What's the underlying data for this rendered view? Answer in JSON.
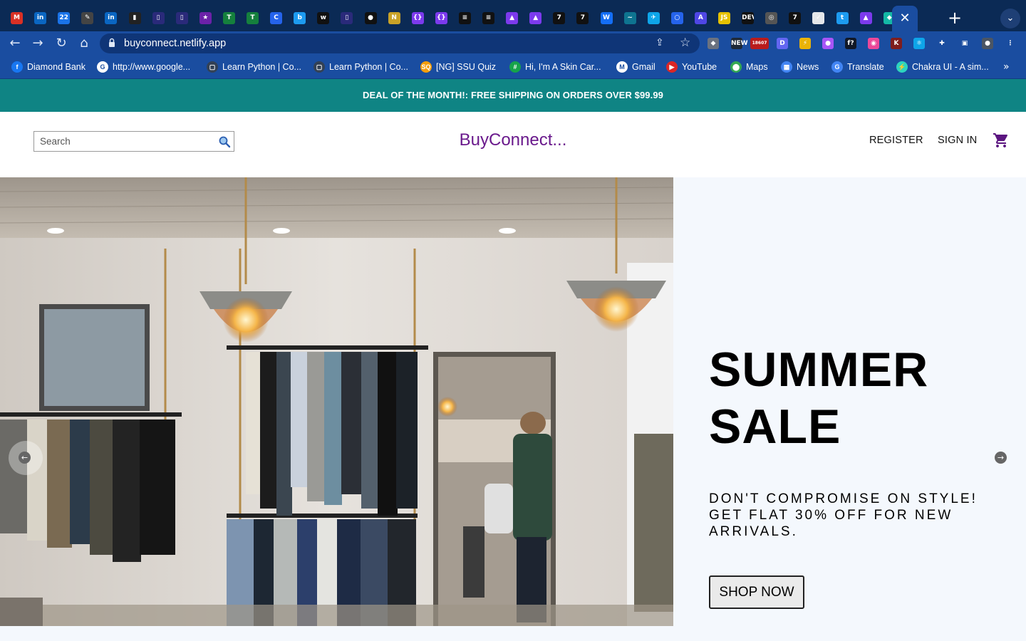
{
  "browser": {
    "tab_favicons": [
      {
        "name": "gmail-icon",
        "glyph": "M",
        "color": "#d93025"
      },
      {
        "name": "linkedin-icon",
        "glyph": "in",
        "color": "#0a66c2"
      },
      {
        "name": "calendar-icon",
        "glyph": "22",
        "color": "#1a73e8"
      },
      {
        "name": "pen-icon",
        "glyph": "✎",
        "color": "#444444"
      },
      {
        "name": "linkedin-icon",
        "glyph": "in",
        "color": "#0a66c2"
      },
      {
        "name": "chart-icon",
        "glyph": "▮",
        "color": "#222222"
      },
      {
        "name": "figure-icon",
        "glyph": "▯",
        "color": "#2a2a7a"
      },
      {
        "name": "figure-icon",
        "glyph": "▯",
        "color": "#2a2a7a"
      },
      {
        "name": "star-icon",
        "glyph": "★",
        "color": "#6b21a8"
      },
      {
        "name": "tree-icon",
        "glyph": "T",
        "color": "#15803d"
      },
      {
        "name": "tree-icon",
        "glyph": "T",
        "color": "#15803d"
      },
      {
        "name": "c-icon",
        "glyph": "C",
        "color": "#2563eb"
      },
      {
        "name": "bird-icon",
        "glyph": "b",
        "color": "#1d9bf0"
      },
      {
        "name": "w-icon",
        "glyph": "w",
        "color": "#111111"
      },
      {
        "name": "figure-icon",
        "glyph": "▯",
        "color": "#2a2a7a"
      },
      {
        "name": "github-icon",
        "glyph": "●",
        "color": "#111111"
      },
      {
        "name": "node-icon",
        "glyph": "N",
        "color": "#c9a227"
      },
      {
        "name": "bracket-icon",
        "glyph": "{}",
        "color": "#7c3aed"
      },
      {
        "name": "bracket-icon",
        "glyph": "{}",
        "color": "#7c3aed"
      },
      {
        "name": "stack-icon",
        "glyph": "≡",
        "color": "#111111"
      },
      {
        "name": "stack-icon",
        "glyph": "≡",
        "color": "#111111"
      },
      {
        "name": "rocket-icon",
        "glyph": "▲",
        "color": "#7c3aed"
      },
      {
        "name": "rocket-icon",
        "glyph": "▲",
        "color": "#7c3aed"
      },
      {
        "name": "seven-icon",
        "glyph": "7",
        "color": "#111111"
      },
      {
        "name": "seven-icon",
        "glyph": "7",
        "color": "#111111"
      },
      {
        "name": "webflow-icon",
        "glyph": "W",
        "color": "#146ef5"
      },
      {
        "name": "tailwind-icon",
        "glyph": "~",
        "color": "#0e7490"
      },
      {
        "name": "bird-icon",
        "glyph": "✈",
        "color": "#0ea5e9"
      },
      {
        "name": "circle-icon",
        "glyph": "○",
        "color": "#2563eb"
      },
      {
        "name": "triangle-icon",
        "glyph": "A",
        "color": "#4f46e5"
      },
      {
        "name": "js-icon",
        "glyph": "JS",
        "color": "#e5c100"
      },
      {
        "name": "dev-icon",
        "glyph": "DEV",
        "color": "#111111"
      },
      {
        "name": "globe-icon",
        "glyph": "◎",
        "color": "#555555"
      },
      {
        "name": "seven-icon",
        "glyph": "7",
        "color": "#111111"
      },
      {
        "name": "doc-icon",
        "glyph": "✓",
        "color": "#e5e7eb"
      },
      {
        "name": "twitter-icon",
        "glyph": "t",
        "color": "#1d9bf0"
      },
      {
        "name": "rocket-icon",
        "glyph": "▲",
        "color": "#7c3aed"
      },
      {
        "name": "diamond-icon",
        "glyph": "◆",
        "color": "#14b8a6"
      }
    ],
    "active_tab_close": "✕",
    "new_tab": "+",
    "tab_menu": "⌄",
    "nav": {
      "back": "←",
      "forward": "→",
      "reload": "↻",
      "home": "⌂"
    },
    "url": "buyconnect.netlify.app",
    "extensions": [
      {
        "name": "puzzle-gray-icon",
        "glyph": "◆",
        "color": "#6b7280"
      },
      {
        "name": "new-badge-icon",
        "glyph": "NEW",
        "color": "#1f2937"
      },
      {
        "name": "mail-counter-icon",
        "glyph": "18607",
        "color": "#b91c1c"
      },
      {
        "name": "d-icon",
        "glyph": "D",
        "color": "#6366f1"
      },
      {
        "name": "bolt-icon",
        "glyph": "⚡",
        "color": "#eab308"
      },
      {
        "name": "ghost-icon",
        "glyph": "●",
        "color": "#a855f7"
      },
      {
        "name": "function-icon",
        "glyph": "f?",
        "color": "#111827"
      },
      {
        "name": "color-wheel-icon",
        "glyph": "◉",
        "color": "#ec4899"
      },
      {
        "name": "k-icon",
        "glyph": "K",
        "color": "#7f1d1d"
      },
      {
        "name": "react-icon",
        "glyph": "⚛",
        "color": "#0ea5e9"
      },
      {
        "name": "extensions-puzzle-icon",
        "glyph": "✚",
        "color": "#1a4da0"
      },
      {
        "name": "sidebar-icon",
        "glyph": "▣",
        "color": "#1a4da0"
      },
      {
        "name": "profile-avatar-icon",
        "glyph": "●",
        "color": "#4b5563"
      },
      {
        "name": "menu-kebab-icon",
        "glyph": "⋮",
        "color": "#1a4da0"
      }
    ],
    "bookmarks": [
      {
        "label": "Diamond Bank",
        "icon": "f",
        "color": "#1877f2"
      },
      {
        "label": "http://www.google...",
        "icon": "G",
        "color": "#ffffff"
      },
      {
        "label": "Learn Python | Co...",
        "icon": "▢",
        "color": "#334155"
      },
      {
        "label": "Learn Python | Co...",
        "icon": "▢",
        "color": "#334155"
      },
      {
        "label": "[NG] SSU Quiz",
        "icon": "SQ",
        "color": "#f59e0b"
      },
      {
        "label": "Hi, I'm A Skin Car...",
        "icon": "#",
        "color": "#16a34a"
      },
      {
        "label": "Gmail",
        "icon": "M",
        "color": "#ffffff"
      },
      {
        "label": "YouTube",
        "icon": "▶",
        "color": "#dc2626"
      },
      {
        "label": "Maps",
        "icon": "⬤",
        "color": "#34a853"
      },
      {
        "label": "News",
        "icon": "▦",
        "color": "#4285f4"
      },
      {
        "label": "Translate",
        "icon": "G",
        "color": "#4285f4"
      },
      {
        "label": "Chakra UI - A sim...",
        "icon": "⚡",
        "color": "#2dd4bf"
      }
    ],
    "bookmarks_more": "»"
  },
  "announcement": "DEAL OF THE MONTH!: FREE SHIPPING ON ORDERS OVER $99.99",
  "header": {
    "search_placeholder": "Search",
    "logo": "BuyConnect...",
    "register": "REGISTER",
    "sign_in": "SIGN IN"
  },
  "hero": {
    "title_line1": "SUMMER",
    "title_line2": "SALE",
    "description": "DON'T COMPROMISE ON STYLE! GET FLAT 30% OFF FOR NEW ARRIVALS.",
    "cta": "SHOP NOW",
    "prev_arrow": "←",
    "next_arrow": "→"
  },
  "colors": {
    "announcement_bg": "#0f8484",
    "logo": "#6a1a8c",
    "hero_bg": "#f4f8fd",
    "browser_tabstrip": "#0b2a55",
    "browser_toolbar": "#1a4da0"
  }
}
